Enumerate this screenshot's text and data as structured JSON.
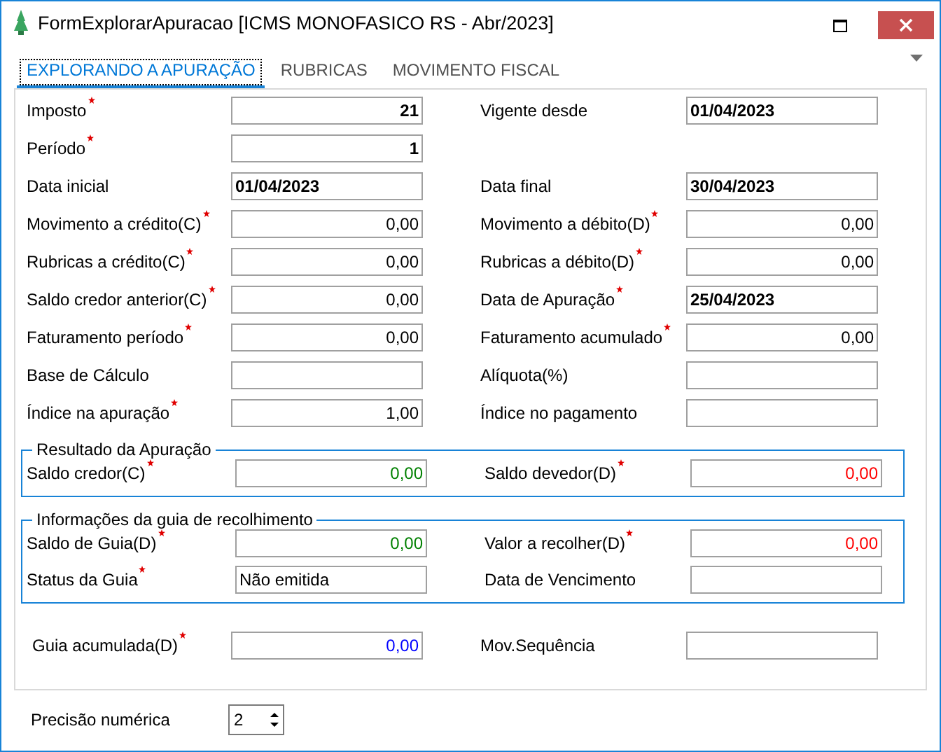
{
  "window": {
    "title": "FormExplorarApuracao [ICMS MONOFASICO RS - Abr/2023]"
  },
  "tabs": [
    {
      "label": "EXPLORANDO A APURAÇÃO",
      "selected": true
    },
    {
      "label": "RUBRICAS",
      "selected": false
    },
    {
      "label": "MOVIMENTO FISCAL",
      "selected": false
    }
  ],
  "rows": [
    {
      "left": {
        "label": "Imposto",
        "required": true,
        "value": "21",
        "kind": "number",
        "bold": true
      },
      "right": {
        "label": "Vigente desde",
        "required": false,
        "value": "01/04/2023",
        "kind": "text",
        "bold": true
      }
    },
    {
      "left": {
        "label": "Período",
        "required": true,
        "value": "1",
        "kind": "number",
        "bold": true
      }
    },
    {
      "left": {
        "label": "Data inicial",
        "required": false,
        "value": "01/04/2023",
        "kind": "text",
        "bold": true
      },
      "right": {
        "label": "Data final",
        "required": false,
        "value": "30/04/2023",
        "kind": "text",
        "bold": true
      }
    },
    {
      "left": {
        "label": "Movimento a crédito(C)",
        "required": true,
        "value": "0,00",
        "kind": "number",
        "bold": false
      },
      "right": {
        "label": "Movimento a débito(D)",
        "required": true,
        "value": "0,00",
        "kind": "number",
        "bold": false
      }
    },
    {
      "left": {
        "label": "Rubricas a crédito(C)",
        "required": true,
        "value": "0,00",
        "kind": "number",
        "bold": false
      },
      "right": {
        "label": "Rubricas a débito(D)",
        "required": true,
        "value": "0,00",
        "kind": "number",
        "bold": false
      }
    },
    {
      "left": {
        "label": "Saldo credor anterior(C)",
        "required": true,
        "value": "0,00",
        "kind": "number",
        "bold": false
      },
      "right": {
        "label": "Data de Apuração",
        "required": true,
        "value": "25/04/2023",
        "kind": "text",
        "bold": true
      }
    },
    {
      "left": {
        "label": "Faturamento período",
        "required": true,
        "value": "0,00",
        "kind": "number",
        "bold": false
      },
      "right": {
        "label": "Faturamento acumulado",
        "required": true,
        "value": "0,00",
        "kind": "number",
        "bold": false
      }
    },
    {
      "left": {
        "label": "Base de Cálculo",
        "required": false
      },
      "right": {
        "label": "Alíquota(%)",
        "required": false
      }
    },
    {
      "left": {
        "label": "Índice na apuração",
        "required": true,
        "value": "1,00",
        "kind": "number",
        "bold": false
      },
      "right": {
        "label": "Índice no pagamento",
        "required": false
      }
    }
  ],
  "groups": [
    {
      "title": "Resultado da Apuração",
      "rows": [
        {
          "left": {
            "label": "Saldo credor(C)",
            "required": true,
            "value": "0,00",
            "kind": "number",
            "bold": false,
            "color": "#008000"
          },
          "right": {
            "label": "Saldo devedor(D)",
            "required": true,
            "value": "0,00",
            "kind": "number",
            "bold": false,
            "color": "#ff0000"
          }
        }
      ]
    },
    {
      "title": "Informações da guia de recolhimento",
      "rows": [
        {
          "left": {
            "label": "Saldo de Guia(D)",
            "required": true,
            "value": "0,00",
            "kind": "number",
            "bold": false,
            "color": "#008000"
          },
          "right": {
            "label": "Valor a recolher(D)",
            "required": true,
            "value": "0,00",
            "kind": "number",
            "bold": false,
            "color": "#ff0000"
          }
        },
        {
          "left": {
            "label": "Status da Guia",
            "required": true,
            "value": "Não emitida",
            "kind": "text",
            "bold": false
          },
          "right": {
            "label": "Data de Vencimento",
            "required": false
          }
        }
      ]
    }
  ],
  "extra_row": {
    "left": {
      "label": "Guia acumulada(D)",
      "required": true,
      "value": "0,00",
      "kind": "number",
      "bold": false,
      "color": "#0000ff"
    },
    "right": {
      "label": "Mov.Sequência",
      "required": false
    }
  },
  "precision": {
    "label": "Precisão numérica",
    "value": "2"
  }
}
